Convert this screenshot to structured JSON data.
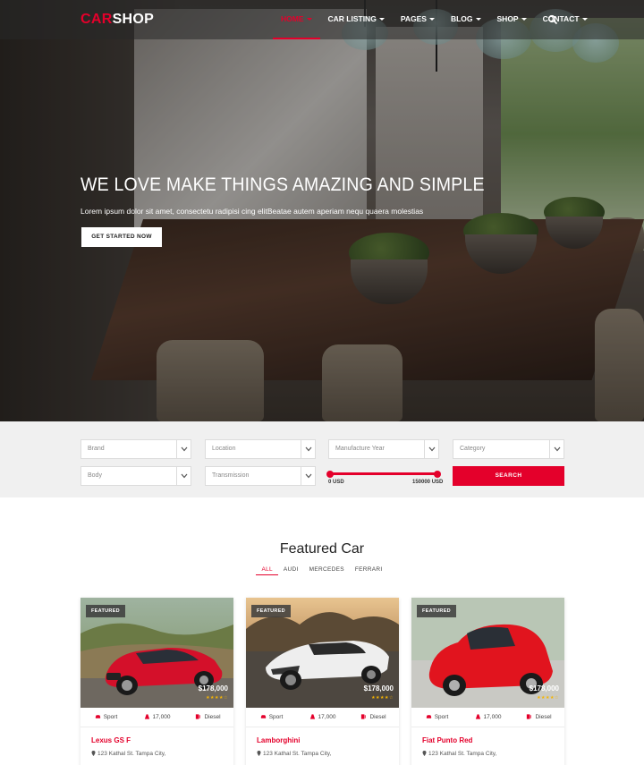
{
  "brand": {
    "logo_part1": "CAR",
    "logo_part2": "SHOP"
  },
  "nav": {
    "items": [
      {
        "label": "HOME",
        "active": true
      },
      {
        "label": "CAR LISTING"
      },
      {
        "label": "PAGES"
      },
      {
        "label": "BLOG"
      },
      {
        "label": "SHOP"
      },
      {
        "label": "CONTACT"
      }
    ],
    "search_icon": "search-icon"
  },
  "hero": {
    "title": "WE LOVE MAKE THINGS AMAZING AND SIMPLE",
    "subtitle": "Lorem ipsum dolor sit amet, consectetu radipisi cing elitBeatae autem aperiam nequ quaera molestias",
    "button": "GET STARTED NOW"
  },
  "search": {
    "brand_placeholder": "Brand",
    "location_placeholder": "Location",
    "year_placeholder": "Manufacture Year",
    "category_placeholder": "Category",
    "body_placeholder": "Body",
    "transmission_placeholder": "Transmission",
    "price_min": "0 USD",
    "price_max": "150000 USD",
    "search_button": "SEARCH"
  },
  "featured": {
    "title": "Featured Car",
    "filters": [
      {
        "label": "ALL",
        "active": true
      },
      {
        "label": "AUDI"
      },
      {
        "label": "MERCEDES"
      },
      {
        "label": "FERRARI"
      }
    ],
    "cards": [
      {
        "badge": "FEATURED",
        "price": "$178,000",
        "stars": "★★★★☆",
        "type": "Sport",
        "mileage": "17,000",
        "fuel": "Diesel",
        "name": "Lexus GS F",
        "address": "123 Kathal St. Tampa City,"
      },
      {
        "badge": "FEATURED",
        "price": "$178,000",
        "stars": "★★★★☆",
        "type": "Sport",
        "mileage": "17,000",
        "fuel": "Diesel",
        "name": "Lamborghini",
        "address": "123 Kathal St. Tampa City,"
      },
      {
        "badge": "FEATURED",
        "price": "$178,000",
        "stars": "★★★★☆",
        "type": "Sport",
        "mileage": "17,000",
        "fuel": "Diesel",
        "name": "Fiat Punto Red",
        "address": "123 Kathal St. Tampa City,"
      }
    ]
  },
  "colors": {
    "accent": "#e4002b",
    "search_bg": "#f0f0f0",
    "star": "#f7b500"
  }
}
